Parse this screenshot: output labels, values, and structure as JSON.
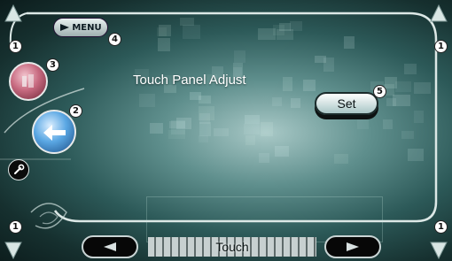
{
  "menu": {
    "label": "MENU"
  },
  "screen": {
    "title": "Touch Panel Adjust"
  },
  "set_button": {
    "label": "Set"
  },
  "status": {
    "text": "Touch"
  },
  "callouts": {
    "c1": "1",
    "c2": "2",
    "c3": "3",
    "c4": "4",
    "c5": "5"
  },
  "colors": {
    "background_dark": "#16302f",
    "background_light": "#a9c9c7",
    "button_face": "#ffffff",
    "accent_blue": "#5aa7e3",
    "accent_red": "#c76a80"
  },
  "icons": [
    "up-arrow-icon",
    "down-arrow-icon",
    "play-triangle-icon",
    "eject-icon",
    "return-icon",
    "wrench-icon",
    "left-arrow-icon",
    "right-arrow-icon"
  ]
}
